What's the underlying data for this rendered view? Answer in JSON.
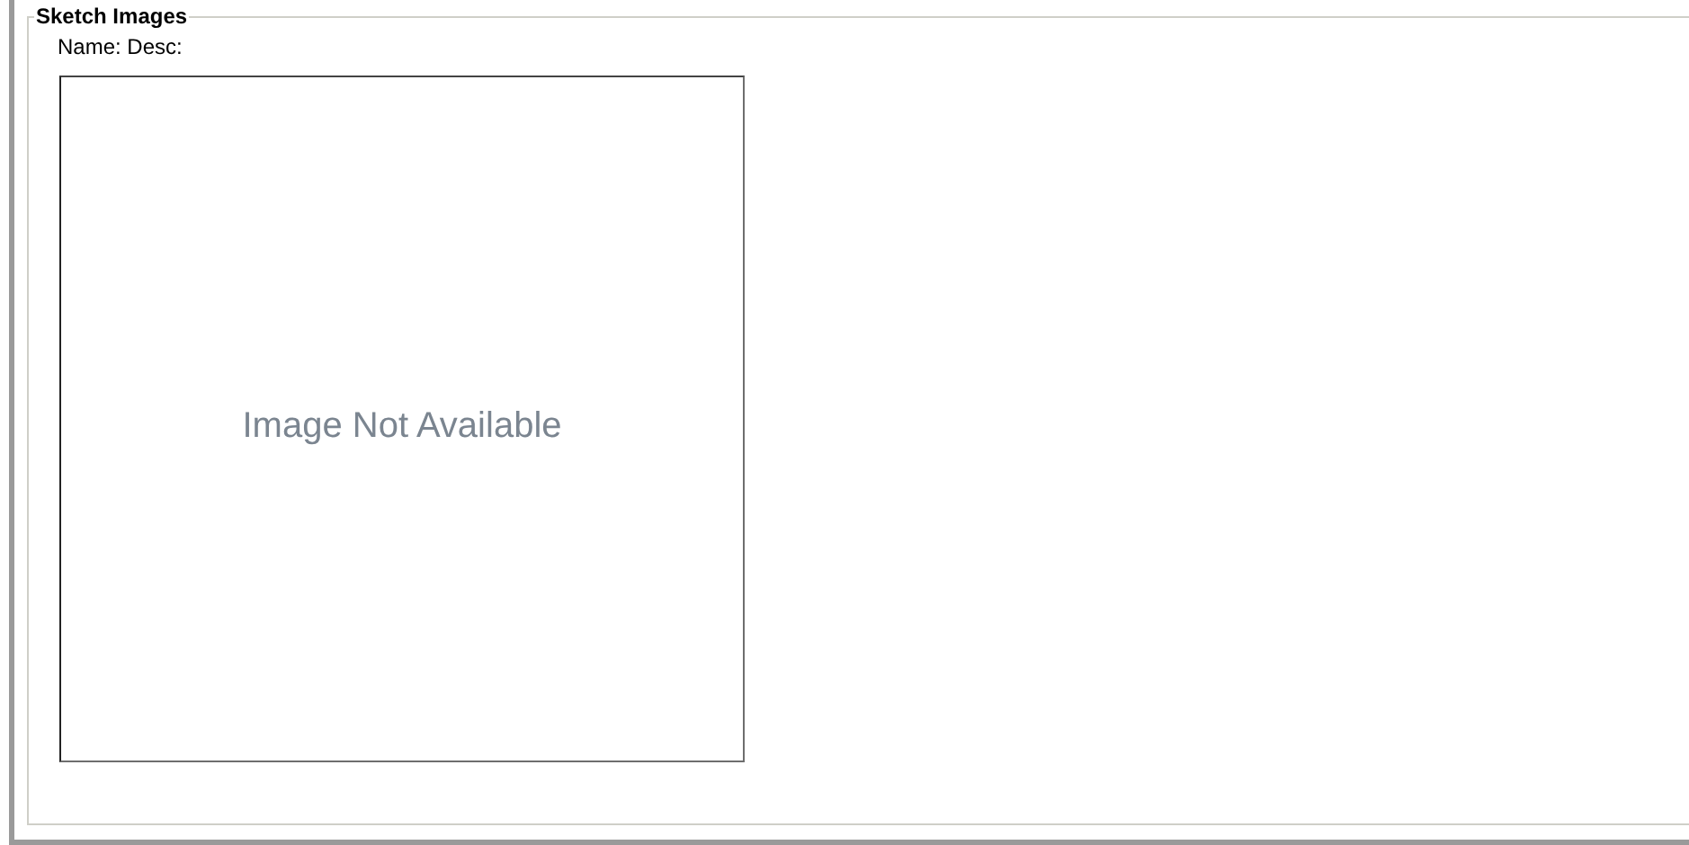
{
  "section": {
    "title": "Sketch Images"
  },
  "caption": "Name: Desc:",
  "image": {
    "placeholder_text": "Image Not Available"
  }
}
